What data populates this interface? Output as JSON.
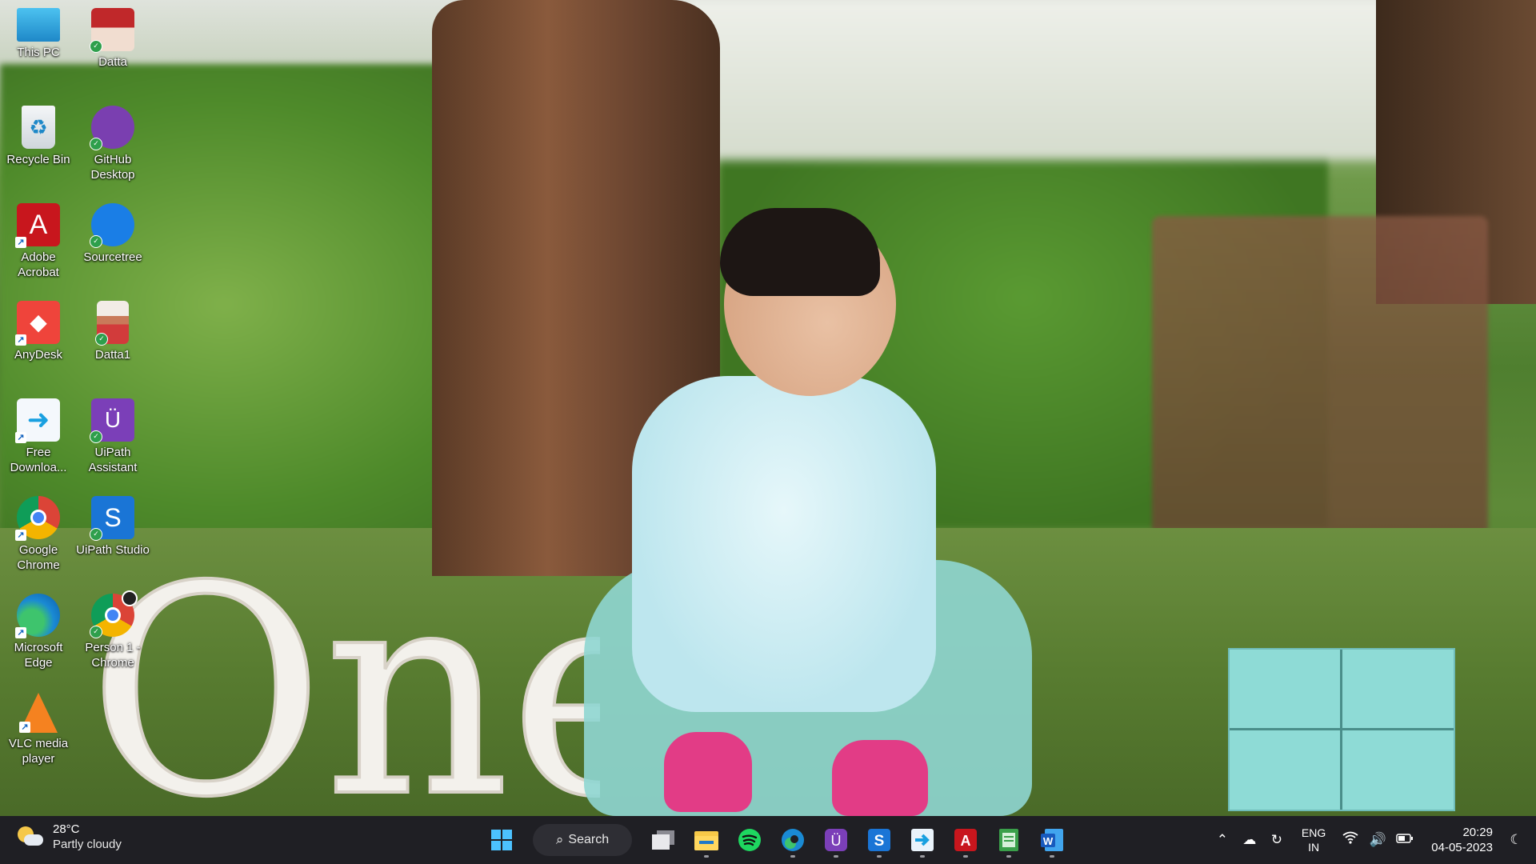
{
  "desktop": {
    "icons": [
      {
        "label": "This PC"
      },
      {
        "label": "Datta"
      },
      {
        "label": "Recycle Bin"
      },
      {
        "label": "GitHub Desktop"
      },
      {
        "label": "Adobe Acrobat"
      },
      {
        "label": "Sourcetree"
      },
      {
        "label": "AnyDesk"
      },
      {
        "label": "Datta1"
      },
      {
        "label": "Free Downloa..."
      },
      {
        "label": "UiPath Assistant"
      },
      {
        "label": "Google Chrome"
      },
      {
        "label": "UiPath Studio"
      },
      {
        "label": "Microsoft Edge"
      },
      {
        "label": "Person 1 - Chrome"
      },
      {
        "label": "VLC media player"
      }
    ],
    "wallpaper_text": "One"
  },
  "taskbar": {
    "weather": {
      "temp": "28°C",
      "condition": "Partly cloudy"
    },
    "search_label": "Search",
    "pinned": [
      "start-icon",
      "task-view-icon",
      "file-explorer-icon",
      "spotify-icon",
      "edge-icon",
      "uipath-assistant-icon",
      "uipath-studio-icon",
      "free-download-manager-icon",
      "acrobat-icon",
      "notepad-icon",
      "word-icon"
    ],
    "tray": {
      "lang_top": "ENG",
      "lang_bottom": "IN",
      "time": "20:29",
      "date": "04-05-2023"
    }
  },
  "colors": {
    "taskbar_bg": "#1f1f24",
    "accent": "#0a7ad6"
  }
}
